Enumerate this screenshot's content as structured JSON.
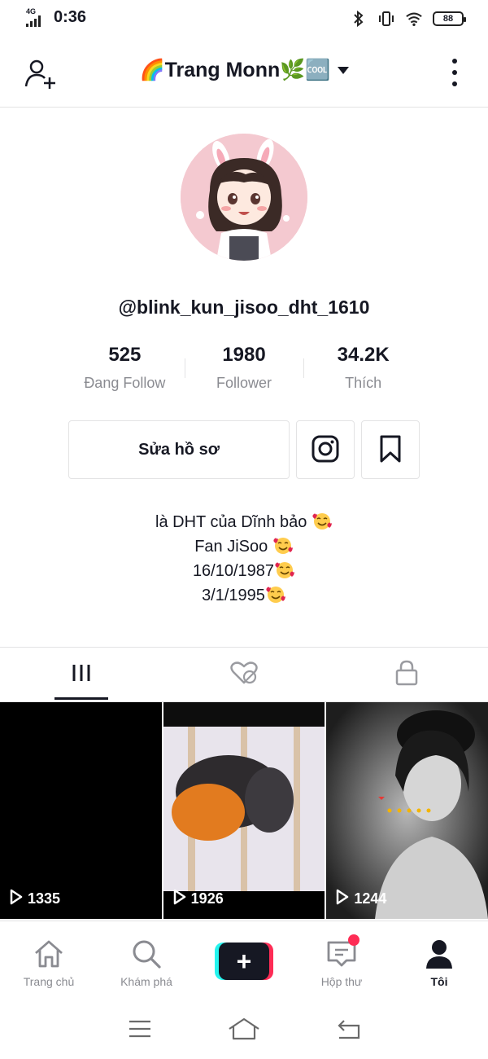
{
  "status_bar": {
    "network": "4G",
    "time": "0:36",
    "battery": "88"
  },
  "header": {
    "title": "🌈Trang Monn🌿🆒"
  },
  "profile": {
    "username": "@blink_kun_jisoo_dht_1610",
    "stats": [
      {
        "value": "525",
        "label": "Đang Follow"
      },
      {
        "value": "1980",
        "label": "Follower"
      },
      {
        "value": "34.2K",
        "label": "Thích"
      }
    ],
    "edit_button": "Sửa hồ sơ",
    "bio": [
      "là DHT của Dĩnh bảo",
      "Fan JiSoo",
      "16/10/1987",
      "3/1/1995"
    ]
  },
  "videos": [
    {
      "views": "1335"
    },
    {
      "views": "1926"
    },
    {
      "views": "1244"
    }
  ],
  "bottom_nav": {
    "home": "Trang chủ",
    "discover": "Khám phá",
    "create": "+",
    "inbox": "Hộp thư",
    "me": "Tôi"
  },
  "colors": {
    "accent_red": "#fe2c55",
    "accent_cyan": "#25f4ee",
    "text_dark": "#161823",
    "text_muted": "#8a8b91"
  }
}
